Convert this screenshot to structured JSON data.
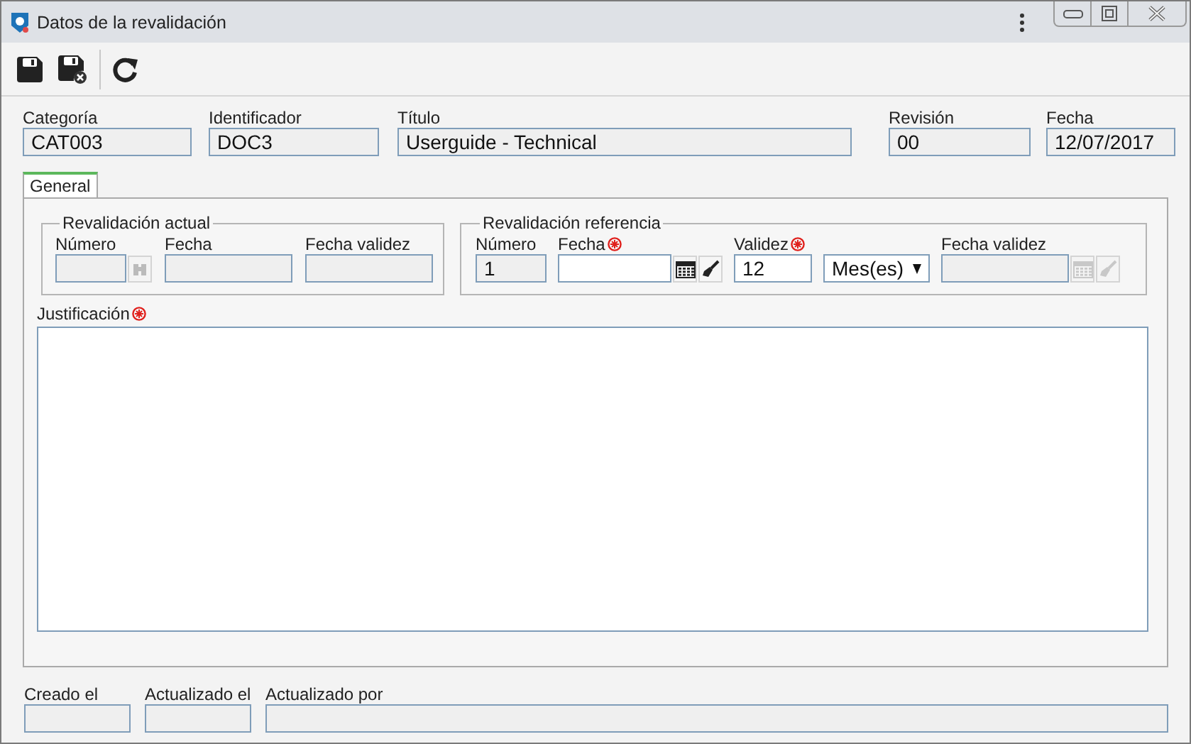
{
  "window": {
    "title": "Datos de la revalidación"
  },
  "header_fields": [
    {
      "label": "Categoría",
      "value": "CAT003",
      "disabled": true
    },
    {
      "label": "Identificador",
      "value": "DOC3",
      "disabled": true
    },
    {
      "label": "Título",
      "value": "Userguide - Technical",
      "disabled": true
    },
    {
      "label": "Revisión",
      "value": "00",
      "disabled": true
    },
    {
      "label": "Fecha",
      "value": "12/07/2017",
      "disabled": true
    }
  ],
  "tabs": [
    {
      "label": "General",
      "selected": true
    }
  ],
  "current_revalidation": {
    "title": "Revalidación actual",
    "fields": [
      {
        "label": "Número",
        "disabled": true,
        "required": false,
        "kind": "lookup"
      },
      {
        "label": "Fecha",
        "disabled": true,
        "required": false,
        "kind": "text"
      },
      {
        "label": "Fecha validez",
        "disabled": true,
        "required": false,
        "kind": "text"
      }
    ]
  },
  "reference_revalidation": {
    "title": "Revalidación referencia",
    "fields": [
      {
        "label": "Número",
        "value": "1",
        "disabled": true,
        "required": false,
        "kind": "text"
      },
      {
        "label": "Fecha",
        "disabled": false,
        "required": true,
        "kind": "date"
      },
      {
        "label": "Validez",
        "value": "12",
        "disabled": false,
        "required": true,
        "kind": "text"
      },
      {
        "value": "Mes(es)",
        "disabled": false,
        "kind": "select"
      },
      {
        "label": "Fecha validez",
        "disabled": true,
        "required": false,
        "kind": "date"
      }
    ]
  },
  "justification": {
    "label": "Justificación",
    "required": true
  },
  "footer_fields": [
    {
      "label": "Creado el",
      "disabled": true
    },
    {
      "label": "Actualizado el",
      "disabled": true
    },
    {
      "label": "Actualizado por",
      "disabled": true
    }
  ]
}
